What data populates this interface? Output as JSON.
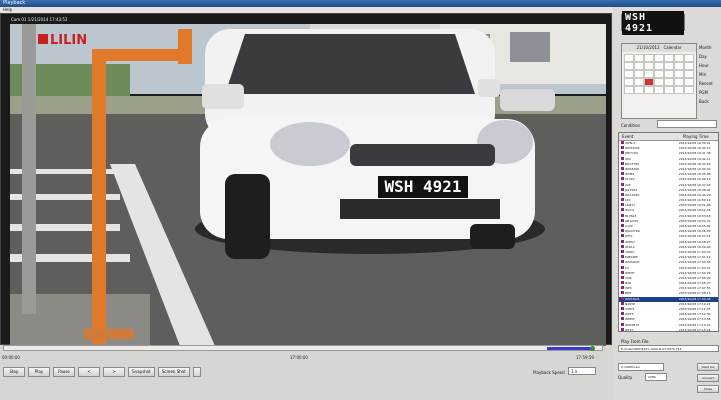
{
  "window": {
    "title": "Playback",
    "menu": "Help"
  },
  "video": {
    "header": "Cam 01  1/21/2014 17:43:52",
    "logo": "LILIN",
    "plate_text": "WSH 4921"
  },
  "timeline": {
    "progress": 0.985,
    "start": "00:00:00",
    "mid": "17:00:00",
    "end": "17:59:59"
  },
  "controls": {
    "stop": "Stop",
    "play": "Play",
    "pause": "Pause",
    "prev": "<",
    "next": ">",
    "snapshot": "Snapshot",
    "screen_shot": "Screen Shot",
    "speed_label": "Playback Speed",
    "speed_value": "1 x"
  },
  "plate_display": "WSH 4921",
  "calendar": {
    "date": "21/10/2013",
    "title": "Calendar",
    "selected_index": 23
  },
  "side_options": [
    "Month",
    "Day",
    "Hour",
    "Min",
    "Recent",
    "PGM",
    "Back"
  ],
  "condition_label": "Condition",
  "events": {
    "headers": [
      "Event",
      "Playing Time"
    ],
    "selected_index": 30,
    "rows": [
      {
        "event": "WPN-3",
        "time": "2013/10/08 16:39:01"
      },
      {
        "event": "WPH4292",
        "time": "2013/10/08 16:40:12"
      },
      {
        "event": "JHE7193",
        "time": "2013/10/08 16:41:38"
      },
      {
        "event": "VK2",
        "time": "2013/10/08 16:42:11"
      },
      {
        "event": "BHV3785",
        "time": "2013/10/08 16:43:50"
      },
      {
        "event": "WPA5490",
        "time": "2013/10/08 16:44:32"
      },
      {
        "event": "WYM2",
        "time": "2013/10/08 16:45:08"
      },
      {
        "event": "S1322",
        "time": "2013/10/08 16:46:19"
      },
      {
        "event": "225",
        "time": "2013/10/08 16:47:03"
      },
      {
        "event": "JPL7584",
        "time": "2013/10/08 16:48:41"
      },
      {
        "event": "WLC2030",
        "time": "2013/10/08 16:49:29"
      },
      {
        "event": "LKS",
        "time": "2013/10/08 16:50:14"
      },
      {
        "event": "L4M17",
        "time": "2013/10/08 16:51:06"
      },
      {
        "event": "WCT3",
        "time": "2013/10/08 16:52:44"
      },
      {
        "event": "BL7603",
        "time": "2013/10/08 16:53:18"
      },
      {
        "event": "AB12321",
        "time": "2013/10/08 16:54:31"
      },
      {
        "event": "C122",
        "time": "2013/10/08 16:55:02"
      },
      {
        "event": "WAA3790",
        "time": "2013/10/08 16:56:49"
      },
      {
        "event": "JHHV",
        "time": "2013/10/08 16:57:15"
      },
      {
        "event": "WWS7",
        "time": "2013/10/08 16:58:27"
      },
      {
        "event": "JWK12",
        "time": "2013/10/08 16:59:40"
      },
      {
        "event": "VWHV",
        "time": "2013/10/08 17:00:33"
      },
      {
        "event": "MM9485",
        "time": "2013/10/08 17:01:12"
      },
      {
        "event": "WSH4921",
        "time": "2013/10/08 17:02:45"
      },
      {
        "event": "C5",
        "time": "2013/10/08 17:03:51"
      },
      {
        "event": "WHM7",
        "time": "2013/10/08 17:04:26"
      },
      {
        "event": "CMS",
        "time": "2013/10/08 17:05:09"
      },
      {
        "event": "N26",
        "time": "2013/10/08 17:06:37"
      },
      {
        "event": "WPC",
        "time": "2013/10/08 17:07:54"
      },
      {
        "event": "BMT",
        "time": "2013/10/08 17:08:16"
      },
      {
        "event": "WSH4921",
        "time": "2013/10/08 17:09:48"
      },
      {
        "event": "N2938",
        "time": "2013/10/08 17:10:22"
      },
      {
        "event": "V3871",
        "time": "2013/10/08 17:11:05"
      },
      {
        "event": "WPT5",
        "time": "2013/10/08 17:12:39"
      },
      {
        "event": "WRM3",
        "time": "2013/10/08 17:13:58"
      },
      {
        "event": "WPA9576",
        "time": "2013/10/08 17:14:21"
      },
      {
        "event": "WF27",
        "time": "2013/10/08 17:15:44"
      },
      {
        "event": "C22",
        "time": "2013/10/08 17:16:07"
      }
    ]
  },
  "play_from_file_label": "Play From File",
  "play_from_file": "E:\\Video\\WSH4921-1200-N-03-0975.712",
  "path": "C:\\VIDEO.avi",
  "quality_label": "Quality",
  "quality_value": "AVML",
  "right_buttons": {
    "start": "Start Ins",
    "convert": "Convert",
    "close": "Close"
  }
}
